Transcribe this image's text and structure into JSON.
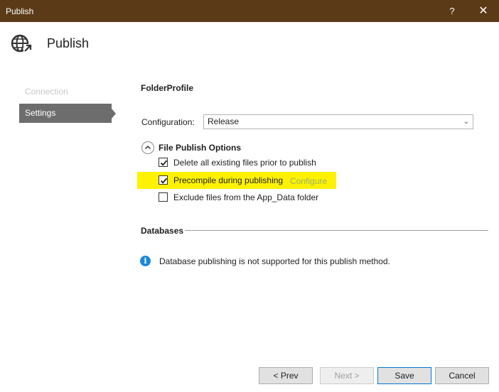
{
  "window": {
    "title": "Publish",
    "help_label": "?",
    "close_label": "✕"
  },
  "header": {
    "title": "Publish",
    "icon": "globe-publish-icon"
  },
  "nav": {
    "items": [
      {
        "label": "Connection",
        "state": "disabled"
      },
      {
        "label": "Settings",
        "state": "selected"
      }
    ]
  },
  "settings": {
    "profile_name": "FolderProfile",
    "configuration_label": "Configuration:",
    "configuration_value": "Release",
    "file_options_title": "File Publish Options",
    "options": [
      {
        "label": "Delete all existing files prior to publish",
        "checked": true
      },
      {
        "label": "Precompile during publishing",
        "checked": true,
        "link": "Configure"
      },
      {
        "label": "Exclude files from the App_Data folder",
        "checked": false
      }
    ],
    "databases_title": "Databases",
    "databases_info": "Database publishing is not supported for this publish method."
  },
  "footer": {
    "prev_label": "< Prev",
    "next_label": "Next >",
    "save_label": "Save",
    "cancel_label": "Cancel"
  },
  "colors": {
    "titlebar": "#5b3a17",
    "nav_selected": "#6d6d6d",
    "highlight": "#fff200",
    "info": "#1c87d8"
  }
}
